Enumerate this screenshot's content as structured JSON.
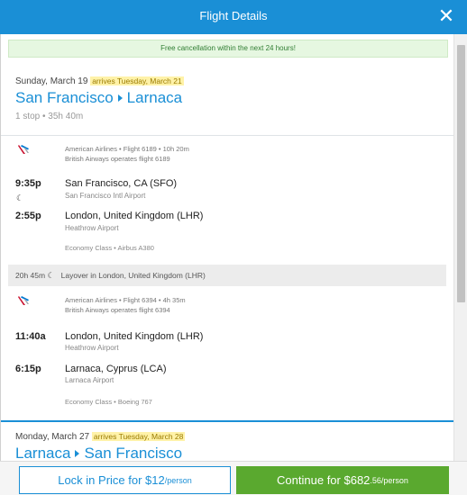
{
  "header": {
    "title": "Flight Details",
    "close_icon": "close-icon"
  },
  "notice": "Free cancellation within the next 24 hours!",
  "outbound": {
    "date": "Sunday, March 19",
    "arrives": "arrives Tuesday, March 21",
    "origin": "San Francisco",
    "destination": "Larnaca",
    "summary": "1 stop • 35h 40m",
    "legs": [
      {
        "airline_line": "American Airlines • Flight 6189 • 10h 20m",
        "operated_by": "British Airways operates flight 6189",
        "depart_time": "9:35p",
        "depart_place": "San Francisco, CA (SFO)",
        "depart_airport": "San Francisco Intl Airport",
        "arrive_time": "2:55p",
        "arrive_place": "London, United Kingdom (LHR)",
        "arrive_airport": "Heathrow Airport",
        "cabin": "Economy Class • Airbus A380"
      },
      {
        "airline_line": "American Airlines • Flight 6394 • 4h 35m",
        "operated_by": "British Airways operates flight 6394",
        "depart_time": "11:40a",
        "depart_place": "London, United Kingdom (LHR)",
        "depart_airport": "Heathrow Airport",
        "arrive_time": "6:15p",
        "arrive_place": "Larnaca, Cyprus (LCA)",
        "arrive_airport": "Larnaca Airport",
        "cabin": "Economy Class • Boeing 767"
      }
    ],
    "layover_duration": "20h 45m",
    "layover_text": "Layover in London, United Kingdom (LHR)"
  },
  "return": {
    "date": "Monday, March 27",
    "arrives": "arrives Tuesday, March 28",
    "origin": "Larnaca",
    "destination": "San Francisco"
  },
  "footer": {
    "lock_label": "Lock in Price for $12",
    "lock_per": "/person",
    "continue_label": "Continue for $682",
    "continue_cents": ".56",
    "continue_per": "/person"
  },
  "colors": {
    "accent": "#1a8fd6",
    "cta": "#5aa92f",
    "notice_bg": "#e6f7e1"
  }
}
